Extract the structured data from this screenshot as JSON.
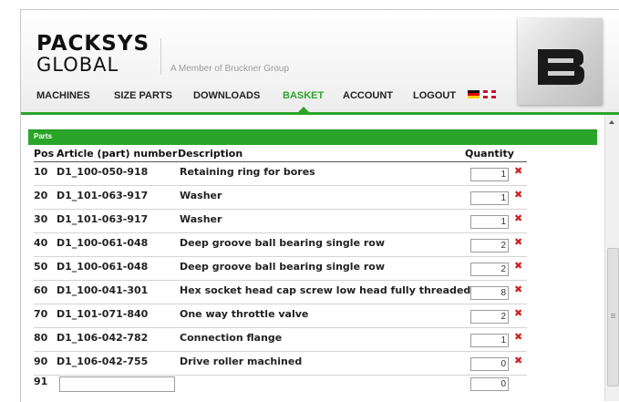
{
  "header": {
    "logo_line1": "PACKSYS",
    "logo_line2": "GLOBAL",
    "tagline": "A Member of Bruckner Group",
    "brand_mark": "B"
  },
  "nav": {
    "items": [
      {
        "label": "MACHINES",
        "active": false
      },
      {
        "label": "SIZE PARTS",
        "active": false
      },
      {
        "label": "DOWNLOADS",
        "active": false
      },
      {
        "label": "BASKET",
        "active": true
      },
      {
        "label": "ACCOUNT",
        "active": false
      },
      {
        "label": "LOGOUT",
        "active": false
      }
    ],
    "flags": [
      "flag-de-icon",
      "flag-uk-icon"
    ]
  },
  "parts": {
    "section_title": "Parts",
    "columns": {
      "pos": "Pos",
      "article": "Article (part) number",
      "description": "Description",
      "quantity": "Quantity"
    },
    "rows": [
      {
        "pos": "10",
        "article": "D1_100-050-918",
        "description": "Retaining ring for bores",
        "quantity": "1"
      },
      {
        "pos": "20",
        "article": "D1_101-063-917",
        "description": "Washer",
        "quantity": "1"
      },
      {
        "pos": "30",
        "article": "D1_101-063-917",
        "description": "Washer",
        "quantity": "1"
      },
      {
        "pos": "40",
        "article": "D1_100-061-048",
        "description": "Deep groove ball bearing single row",
        "quantity": "2"
      },
      {
        "pos": "50",
        "article": "D1_100-061-048",
        "description": "Deep groove ball bearing single row",
        "quantity": "2"
      },
      {
        "pos": "60",
        "article": "D1_100-041-301",
        "description": "Hex socket head cap screw low head fully threaded",
        "quantity": "8"
      },
      {
        "pos": "70",
        "article": "D1_101-071-840",
        "description": "One way throttle valve",
        "quantity": "2"
      },
      {
        "pos": "80",
        "article": "D1_106-042-782",
        "description": "Connection flange",
        "quantity": "1"
      },
      {
        "pos": "90",
        "article": "D1_106-042-755",
        "description": "Drive roller machined",
        "quantity": "0"
      }
    ],
    "new_row": {
      "pos": "91",
      "article": "",
      "quantity": "0"
    },
    "delete_symbol": "✖"
  },
  "colors": {
    "accent": "#2aa52a",
    "delete": "#cc2222"
  }
}
